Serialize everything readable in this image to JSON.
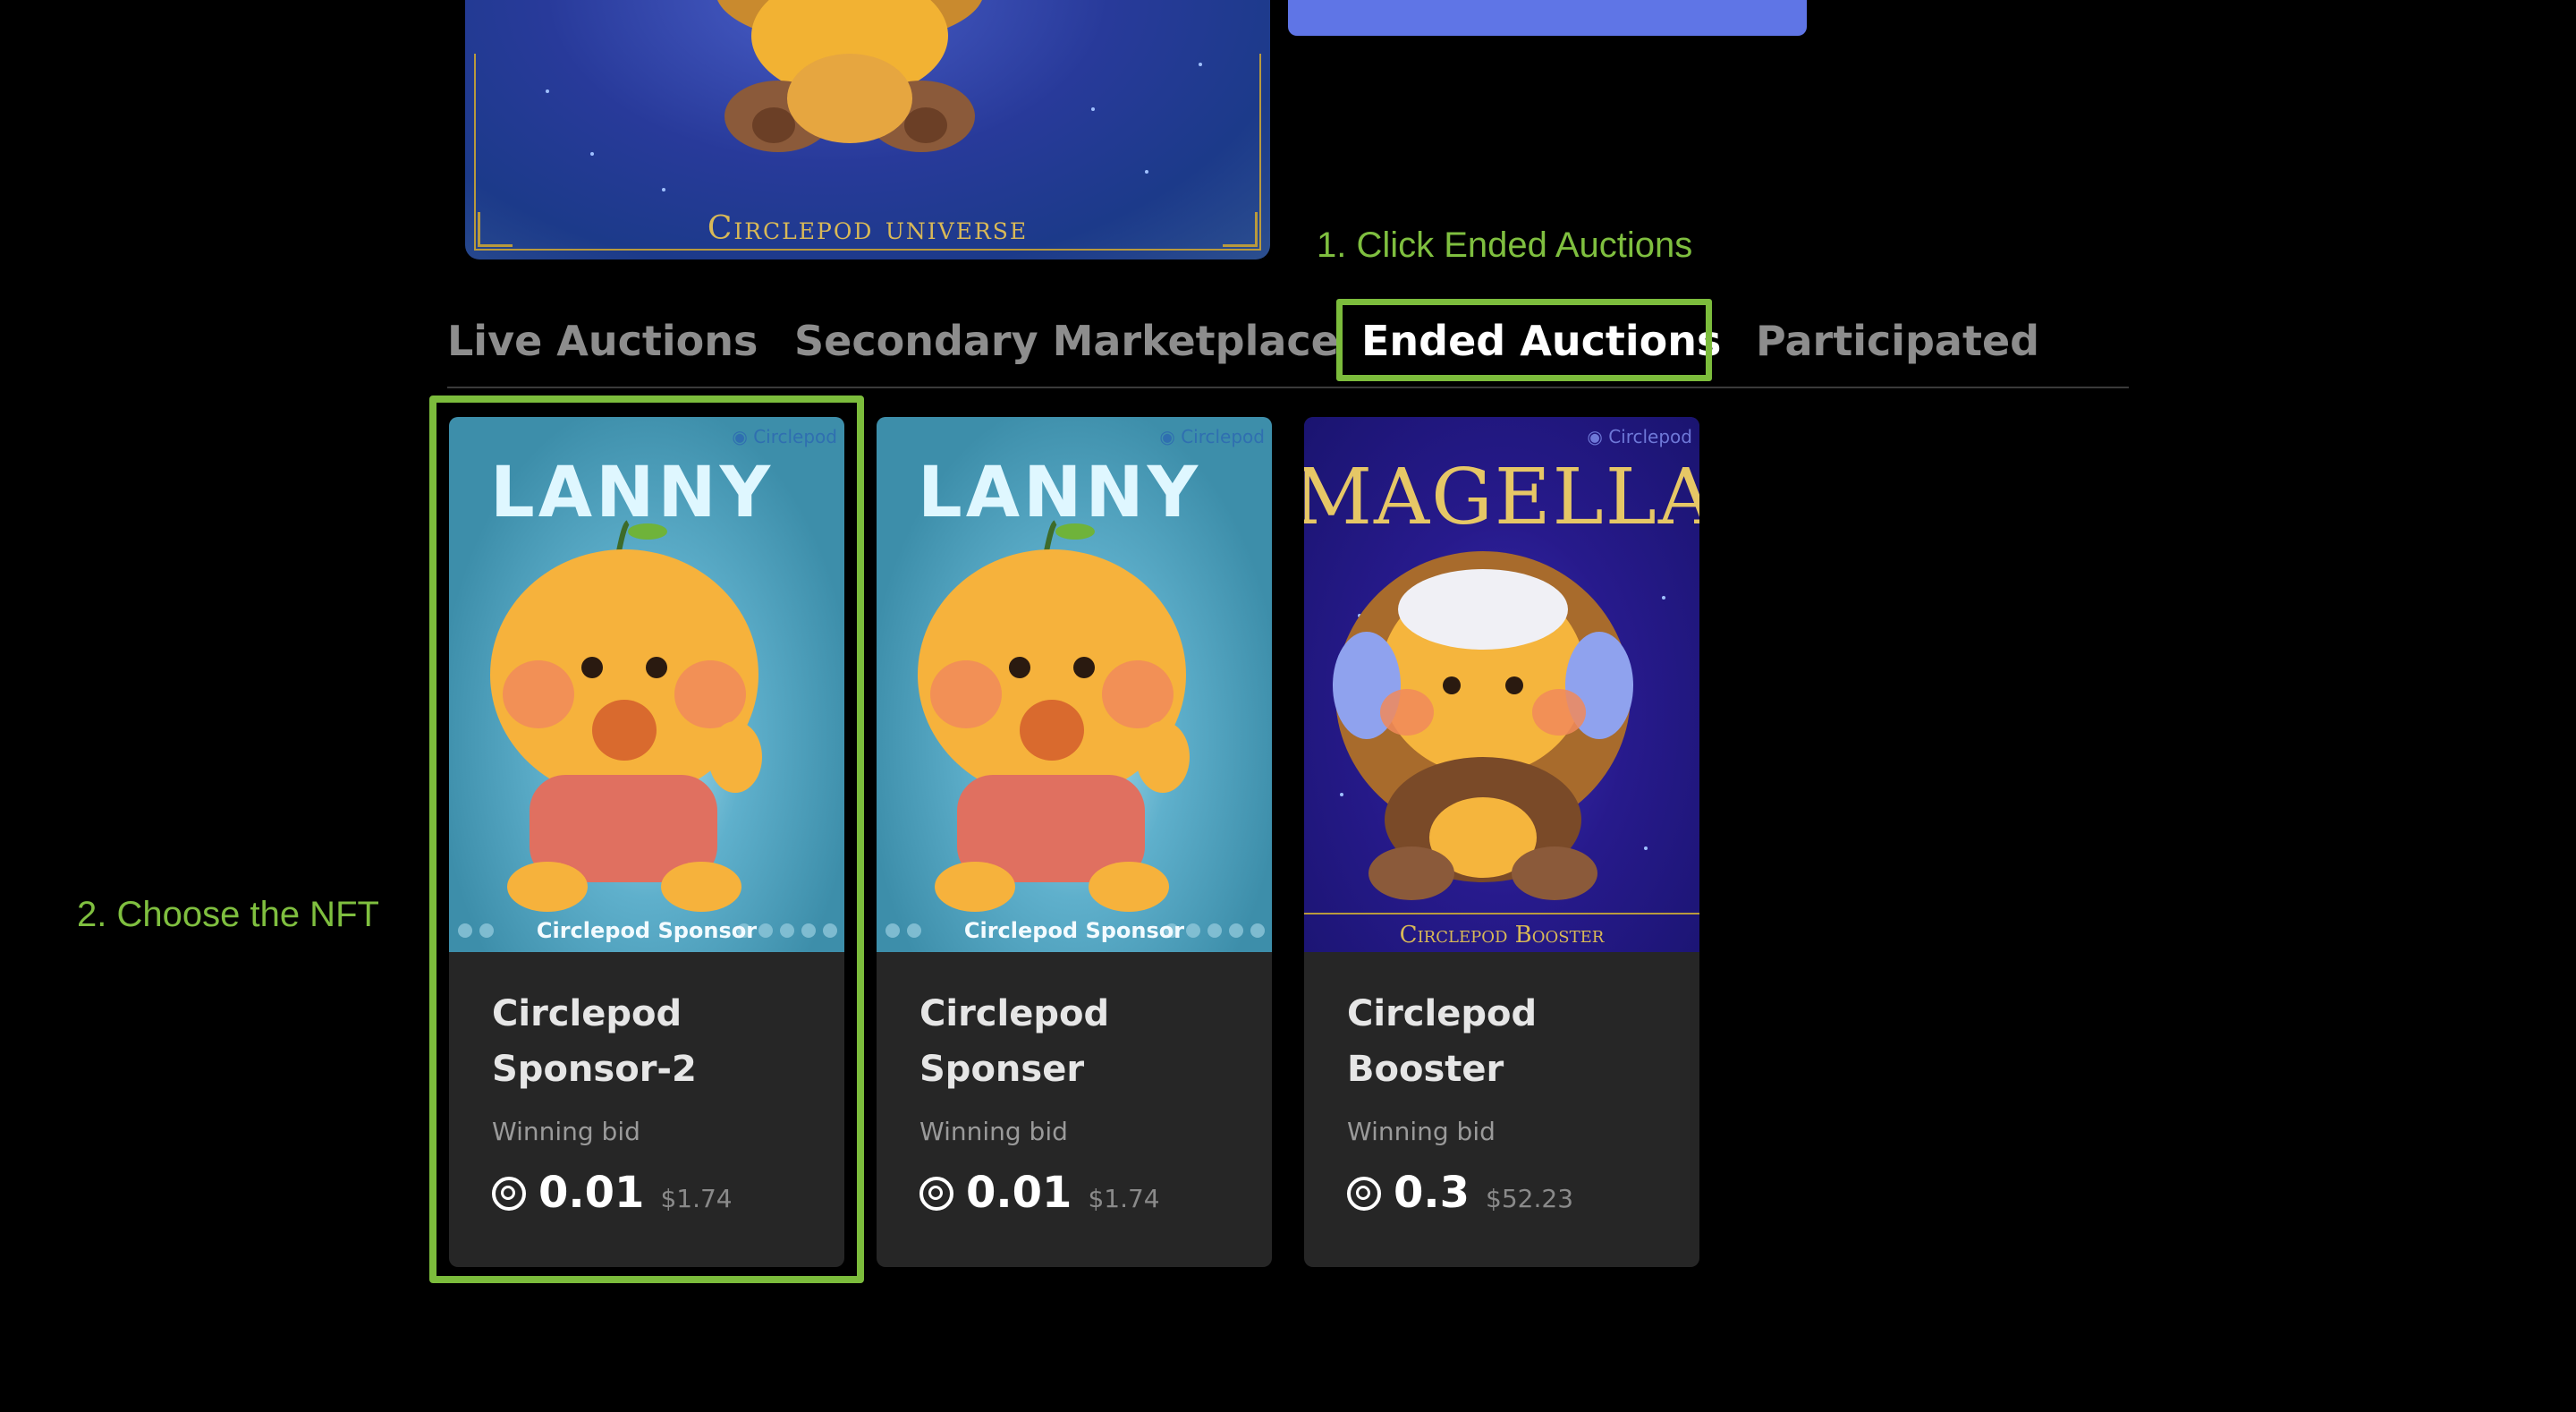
{
  "hero": {
    "caption": "Circlepod universe",
    "colors": {
      "frame": "#b99a3d",
      "caption": "#d9b957",
      "sky": "#283a9a"
    }
  },
  "annotations": {
    "step1": "1. Click Ended Auctions",
    "step2": "2. Choose the NFT",
    "highlight_color": "#7cbc3c"
  },
  "tabs": [
    {
      "label": "Live Auctions",
      "active": false
    },
    {
      "label": "Secondary Marketplace",
      "active": false
    },
    {
      "label": "Ended Auctions",
      "active": true
    },
    {
      "label": "Participated",
      "active": false
    }
  ],
  "cards": [
    {
      "art_title": "LANNY",
      "art_brand": "Circlepod",
      "art_caption": "Circlepod Sponsor",
      "name_line1": "Circlepod",
      "name_line2": "Sponsor-2",
      "bid_label": "Winning bid",
      "price": "0.01",
      "usd": "$1.74",
      "coin_icon": "circlepod-coin-icon",
      "highlighted": true
    },
    {
      "art_title": "LANNY",
      "art_brand": "Circlepod",
      "art_caption": "Circlepod Sponsor",
      "name_line1": "Circlepod",
      "name_line2": "Sponser",
      "bid_label": "Winning bid",
      "price": "0.01",
      "usd": "$1.74",
      "coin_icon": "circlepod-coin-icon",
      "highlighted": false
    },
    {
      "art_title": "MAGELLAN",
      "art_brand": "Circlepod",
      "art_caption": "Circlepod Booster",
      "name_line1": "Circlepod",
      "name_line2": "Booster",
      "bid_label": "Winning bid",
      "price": "0.3",
      "usd": "$52.23",
      "coin_icon": "circlepod-coin-icon",
      "highlighted": false
    }
  ]
}
